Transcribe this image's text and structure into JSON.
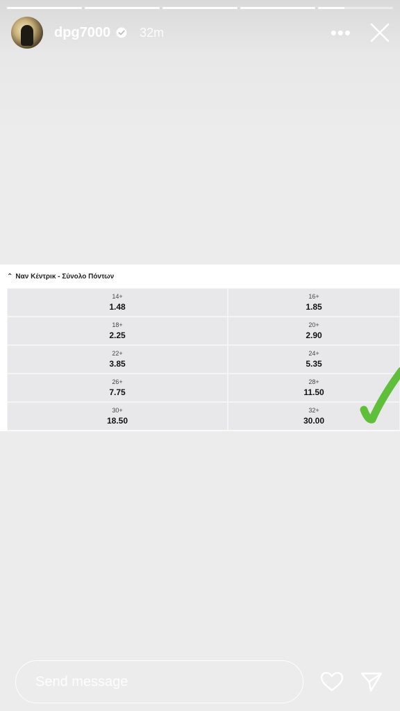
{
  "story": {
    "progress_segments": [
      1,
      1,
      1,
      1,
      0.35
    ],
    "username": "dpg7000",
    "time_ago": "32m",
    "more_label": "•••"
  },
  "market": {
    "title": "Ναν Κέντρικ - Σύνολο Πόντων",
    "rows": [
      [
        {
          "label": "14+",
          "odds": "1.48"
        },
        {
          "label": "16+",
          "odds": "1.85"
        }
      ],
      [
        {
          "label": "18+",
          "odds": "2.25"
        },
        {
          "label": "20+",
          "odds": "2.90"
        }
      ],
      [
        {
          "label": "22+",
          "odds": "3.85"
        },
        {
          "label": "24+",
          "odds": "5.35"
        }
      ],
      [
        {
          "label": "26+",
          "odds": "7.75"
        },
        {
          "label": "28+",
          "odds": "11.50"
        }
      ],
      [
        {
          "label": "30+",
          "odds": "18.50"
        },
        {
          "label": "32+",
          "odds": "30.00"
        }
      ]
    ]
  },
  "reply": {
    "placeholder": "Send message"
  },
  "colors": {
    "check": "#5fbf3a",
    "background": "#ececed"
  }
}
